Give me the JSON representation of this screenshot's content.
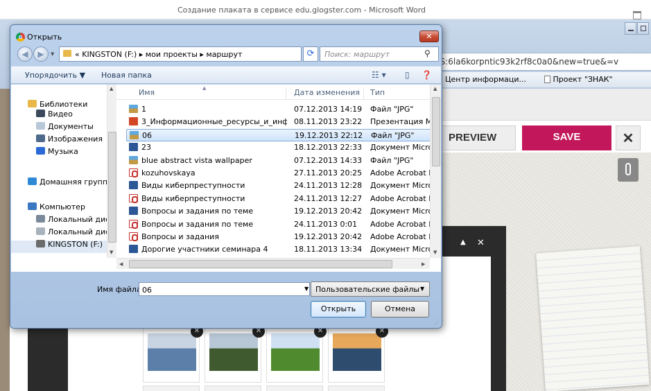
{
  "word": {
    "title": "Создание плаката в сервисе edu.glogster.com  -  Microsoft Word"
  },
  "browser": {
    "address": "nS:6la6korpntic93k2rf8c0a0&new=true&=v",
    "bookmarks": [
      "Центр информаци...",
      "Проект \"ЗНАК\""
    ]
  },
  "glogster": {
    "preview_label": "PREVIEW",
    "save_label": "SAVE",
    "close_label": "✕",
    "save_color": "#c2185b"
  },
  "dialog": {
    "title": "Открыть",
    "close_label": "✕",
    "breadcrumb": "« KINGSTON (F:)  ▸  мои проекты  ▸  маршрут",
    "search_placeholder": "Поиск: маршрут",
    "toolbar": {
      "organize": "Упорядочить ▼",
      "new_folder": "Новая папка"
    },
    "nav_pane": [
      {
        "label": "Библиотеки",
        "level": 0,
        "icon": "libraries-icon",
        "color": "#e8b94a"
      },
      {
        "label": "Видео",
        "level": 1,
        "icon": "video-icon",
        "color": "#3a4a5c"
      },
      {
        "label": "Документы",
        "level": 1,
        "icon": "documents-icon",
        "color": "#b9c8d8"
      },
      {
        "label": "Изображения",
        "level": 1,
        "icon": "pictures-icon",
        "color": "#4d6a8a"
      },
      {
        "label": "Музыка",
        "level": 1,
        "icon": "music-icon",
        "color": "#2b6ad6"
      },
      {
        "label": "Домашняя группа",
        "level": 0,
        "icon": "homegroup-icon",
        "color": "#2e8ad6"
      },
      {
        "label": "Компьютер",
        "level": 0,
        "icon": "computer-icon",
        "color": "#3a78c2"
      },
      {
        "label": "Локальный диск",
        "level": 1,
        "icon": "local-disk-icon",
        "color": "#7a8a9a"
      },
      {
        "label": "Локальный диск",
        "level": 1,
        "icon": "local-disk-icon",
        "color": "#a9b3bd"
      },
      {
        "label": "KINGSTON (F:)",
        "level": 1,
        "icon": "usb-drive-icon",
        "color": "#6b6b6b"
      }
    ],
    "columns": {
      "name": "Имя",
      "date": "Дата изменения",
      "type": "Тип"
    },
    "files": [
      {
        "name": "1",
        "date": "07.12.2013 14:19",
        "type": "Файл \"JPG\"",
        "kind": "jpg"
      },
      {
        "name": "3_Информационные_ресурсы_и_инфо...",
        "date": "08.11.2013 23:22",
        "type": "Презентация Mic",
        "kind": "ppt"
      },
      {
        "name": "06",
        "date": "19.12.2013 22:12",
        "type": "Файл \"JPG\"",
        "kind": "jpg",
        "selected": true
      },
      {
        "name": "23",
        "date": "18.12.2013 22:33",
        "type": "Документ Micros",
        "kind": "doc"
      },
      {
        "name": "blue abstract vista wallpaper",
        "date": "07.12.2013 14:33",
        "type": "Файл \"JPG\"",
        "kind": "jpg"
      },
      {
        "name": "kozuhovskaya",
        "date": "27.11.2013 20:25",
        "type": "Adobe Acrobat D",
        "kind": "pdf"
      },
      {
        "name": "Виды киберпреступности",
        "date": "24.11.2013 12:28",
        "type": "Документ Micros",
        "kind": "doc"
      },
      {
        "name": "Виды киберпреступности",
        "date": "24.11.2013 12:27",
        "type": "Adobe Acrobat D",
        "kind": "pdf"
      },
      {
        "name": "Вопросы и задания по теме",
        "date": "19.12.2013 20:42",
        "type": "Документ Micros",
        "kind": "doc"
      },
      {
        "name": "Вопросы и задания по теме",
        "date": "24.11.2013 0:01",
        "type": "Adobe Acrobat D",
        "kind": "pdf"
      },
      {
        "name": "Вопросы и задания",
        "date": "19.12.2013 20:42",
        "type": "Adobe Acrobat D",
        "kind": "pdf"
      },
      {
        "name": "Дорогие участники семинара 4",
        "date": "18.11.2013 13:34",
        "type": "Документ Micros",
        "kind": "doc"
      }
    ],
    "filename_label": "Имя файла:",
    "filename_value": "06",
    "filetype_value": "Пользовательские файлы",
    "open_label": "Открыть",
    "cancel_label": "Отмена"
  },
  "photos": [
    {
      "name": "photo-collage",
      "c1": "#5b7fa8",
      "c2": "#c8d4e2"
    },
    {
      "name": "photo-forest-path",
      "c1": "#3f5a2e",
      "c2": "#b8c7d6"
    },
    {
      "name": "photo-tree",
      "c1": "#4f8a2f",
      "c2": "#cfe0f2"
    },
    {
      "name": "photo-lake-sunset",
      "c1": "#2d4c6e",
      "c2": "#e8a85c"
    }
  ]
}
